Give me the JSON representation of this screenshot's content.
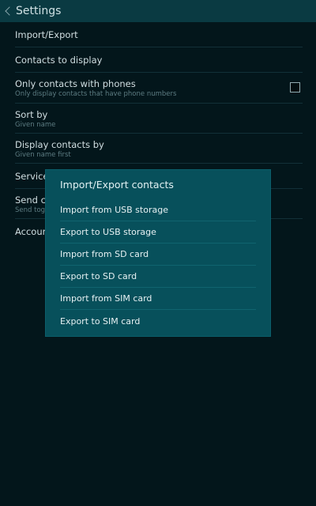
{
  "header": {
    "title": "Settings"
  },
  "settings": [
    {
      "primary": "Import/Export"
    },
    {
      "primary": "Contacts to display"
    },
    {
      "primary": "Only contacts with phones",
      "secondary": "Only display contacts that have phone numbers"
    },
    {
      "primary": "Sort by",
      "secondary": "Given name"
    },
    {
      "primary": "Display contacts by",
      "secondary": "Given name first"
    },
    {
      "primary": "Service"
    },
    {
      "primary": "Send co",
      "secondary": "Send toge"
    },
    {
      "primary": "Account"
    }
  ],
  "dialog": {
    "title": "Import/Export contacts",
    "items": [
      "Import from USB storage",
      "Export to USB storage",
      "Import from SD card",
      "Export to SD card",
      "Import from SIM card",
      "Export to SIM card"
    ]
  }
}
